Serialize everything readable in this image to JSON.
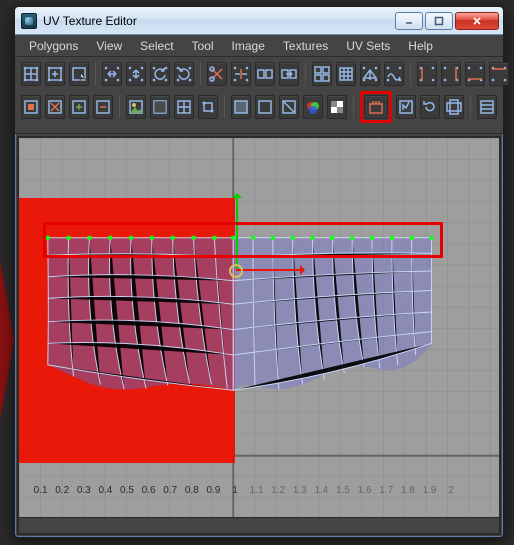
{
  "window": {
    "title": "UV Texture Editor"
  },
  "menus": [
    "Polygons",
    "View",
    "Select",
    "Tool",
    "Image",
    "Textures",
    "UV Sets",
    "Help"
  ],
  "toolbar": {
    "row1": [
      {
        "name": "uv-lattice-tool",
        "group": 0
      },
      {
        "name": "move-uv-shell-tool",
        "group": 0
      },
      {
        "name": "select-shortest-edge-tool",
        "group": 0
      },
      {
        "name": "flip-u",
        "group": 1
      },
      {
        "name": "flip-v",
        "group": 1
      },
      {
        "name": "rotate-ccw",
        "group": 1
      },
      {
        "name": "rotate-cw",
        "group": 1
      },
      {
        "name": "cut-uv-edges",
        "group": 2
      },
      {
        "name": "split-uvs",
        "group": 2
      },
      {
        "name": "sew-uv-edges",
        "group": 2
      },
      {
        "name": "move-and-sew-uvs",
        "group": 2
      },
      {
        "name": "layout-uvs",
        "group": 3
      },
      {
        "name": "grid-uvs",
        "group": 3
      },
      {
        "name": "unfold-uvs",
        "group": 3
      },
      {
        "name": "relax-uvs",
        "group": 3
      },
      {
        "name": "align-u-min",
        "group": 4
      },
      {
        "name": "align-u-max",
        "group": 4
      },
      {
        "name": "align-v-min",
        "group": 4
      },
      {
        "name": "align-v-max",
        "group": 4
      }
    ],
    "row2": [
      {
        "name": "isolate-select-toggle",
        "group": 0
      },
      {
        "name": "remove-all-isolated",
        "group": 0
      },
      {
        "name": "add-selected-to-isolate",
        "group": 0
      },
      {
        "name": "remove-selected-from-isolate",
        "group": 0
      },
      {
        "name": "display-image",
        "group": 1
      },
      {
        "name": "dim-image",
        "group": 1
      },
      {
        "name": "display-grid",
        "group": 1
      },
      {
        "name": "pixel-snap",
        "group": 1
      },
      {
        "name": "shade-uvs",
        "group": 2
      },
      {
        "name": "display-uv-distortion",
        "group": 2
      },
      {
        "name": "toggle-filtered-display",
        "group": 2
      },
      {
        "name": "display-rgb-channels",
        "group": 2
      },
      {
        "name": "display-alpha-channel",
        "group": 2
      },
      {
        "name": "uv-texture-editor-baking",
        "group": 3,
        "highlight": true
      },
      {
        "name": "update-psd-networks",
        "group": 3
      },
      {
        "name": "force-editor-rebake",
        "group": 3
      },
      {
        "name": "use-image-ratio",
        "group": 3
      },
      {
        "name": "uv-editor-options",
        "group": 4
      }
    ],
    "face_button": "toggle-shaded-display",
    "check_button": "show-checker"
  },
  "ruler_labels": [
    "0.1",
    "0.2",
    "0.3",
    "0.4",
    "0.5",
    "0.6",
    "0.7",
    "0.8",
    "0.9",
    "1",
    "1.1",
    "1.2",
    "1.3",
    "1.4",
    "1.5",
    "1.6",
    "1.7",
    "1.8",
    "1.9",
    "2"
  ],
  "colors": {
    "accent_red": "#e10000",
    "grid": "#888888",
    "uv_range": "#e10000",
    "mesh": "#8fb8ff",
    "highlight": "#e60000"
  }
}
